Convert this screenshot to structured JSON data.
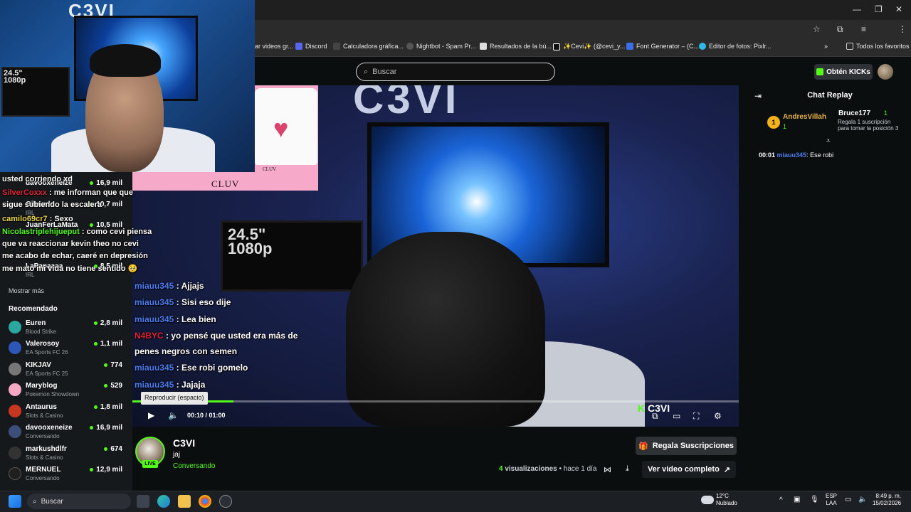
{
  "browser": {
    "bookmarks": [
      {
        "label": "ar videos gr...",
        "icon": "folder-icon"
      },
      {
        "label": "Discord",
        "icon": "discord-icon"
      },
      {
        "label": "Calculadora gráfica...",
        "icon": "calculator-icon"
      },
      {
        "label": "Nightbot - Spam Pr...",
        "icon": "nightbot-icon"
      },
      {
        "label": "Resultados de la bú...",
        "icon": "search-result-icon"
      },
      {
        "label": "✨Cevi✨ (@cevi_y...",
        "icon": "tiktok-icon"
      },
      {
        "label": "Font Generator – (C...",
        "icon": "font-icon"
      },
      {
        "label": "Editor de fotos: Pixlr...",
        "icon": "pixlr-icon"
      }
    ],
    "all_bookmarks": "Todos los favoritos"
  },
  "header": {
    "search_placeholder": "Buscar",
    "kicks_button": "Obtén KICKs"
  },
  "sidebar": {
    "top_list": [
      {
        "name": "davooxeneize",
        "category": "",
        "viewers": "16,9 mil"
      },
      {
        "name": "Gibaudo",
        "category": "IRL",
        "viewers": "10,7 mil"
      },
      {
        "name": "JuanFerLaMata",
        "category": "",
        "viewers": "10,5 mil"
      },
      {
        "name": "LaPapaaaa",
        "category": "IRL",
        "viewers": "8,5 mil"
      }
    ],
    "show_more": "Mostrar más",
    "recommended_heading": "Recomendado",
    "recommended": [
      {
        "name": "Euren",
        "category": "Blood Strike",
        "viewers": "2,8 mil"
      },
      {
        "name": "Valerosoy",
        "category": "EA Sports FC 26",
        "viewers": "1,1 mil"
      },
      {
        "name": "KIKJAV",
        "category": "EA Sports FC 25",
        "viewers": "774"
      },
      {
        "name": "Maryblog",
        "category": "Pokemon Showdown",
        "viewers": "529"
      },
      {
        "name": "Antaurus",
        "category": "Slots & Casino",
        "viewers": "1,8 mil"
      },
      {
        "name": "davooxeneize",
        "category": "Conversando",
        "viewers": "16,9 mil"
      },
      {
        "name": "markushdlfr",
        "category": "Slots & Casino",
        "viewers": "674"
      },
      {
        "name": "MERNUEL",
        "category": "Conversando",
        "viewers": "12,9 mil"
      }
    ]
  },
  "stream_chat_overlay_left": [
    {
      "user": "",
      "text": "usted corriendo xd"
    },
    {
      "user": "SilverCoxxx",
      "text": ": me informan que que"
    },
    {
      "user": "",
      "text": "sigue subiendo la escalera"
    },
    {
      "user": "camilo69cr7",
      "text": ": Sexo"
    },
    {
      "user": "Nicolastriplehijueput",
      "text": ": como cevi piensa"
    },
    {
      "user": "",
      "text": "que va reaccionar kevin theo no cevi"
    },
    {
      "user": "",
      "text": "me acabo de echar, caeré en depresión"
    },
    {
      "user": "",
      "text": "me mato mi vida no tiene sentido 🥺"
    }
  ],
  "stream_chat_overlay_video": [
    {
      "user": "miauu345",
      "text": ": Ajjajs",
      "red": false
    },
    {
      "user": "miauu345",
      "text": ": Sisi eso dije",
      "red": false
    },
    {
      "user": "miauu345",
      "text": ": Lea bien",
      "red": false
    },
    {
      "user": "N4BYC",
      "text": ": yo pensé que usted era más de",
      "red": true
    },
    {
      "user": "",
      "text": "penes negros con semen",
      "red": false
    },
    {
      "user": "miauu345",
      "text": ": Ese robi gomelo",
      "red": false
    },
    {
      "user": "miauu345",
      "text": ": Jajaja",
      "red": false
    }
  ],
  "ad": {
    "brand": "CLUV",
    "brand_small": "CLUV"
  },
  "player": {
    "tooltip": "Reproducir (espacio)",
    "current_time": "00:10",
    "duration": "01:00",
    "progress": 0.167,
    "watermark": "C3VI"
  },
  "chat_replay": {
    "title": "Chat Replay",
    "top_gifters": [
      {
        "rank": "1",
        "name": "AndresVillah",
        "count": "1"
      },
      {
        "name": "Bruce177",
        "count": "1",
        "note": "Regala 1 suscripción para tomar la posición 3"
      }
    ],
    "messages": [
      {
        "time": "00:01",
        "user": "miauu345",
        "text": ": Ese robi"
      }
    ]
  },
  "channel": {
    "name": "C3VI",
    "title": "jaj",
    "category": "Conversando",
    "live_badge": "LIVE",
    "gift_button": "Regala Suscripciones",
    "views_count": "4",
    "views_label": "visualizaciones",
    "posted": "hace 1 día",
    "full_video_button": "Ver video completo"
  },
  "taskbar": {
    "search": "Buscar",
    "weather_temp": "12°C",
    "weather_desc": "Nublado",
    "lang": "ESP",
    "lang2": "LAA",
    "time": "8:49 p. m.",
    "date": "15/02/2026"
  },
  "colors": {
    "kick_green": "#53fc18",
    "chat_user_blue": "#4d7df0",
    "chat_user_red": "#e0223b"
  }
}
